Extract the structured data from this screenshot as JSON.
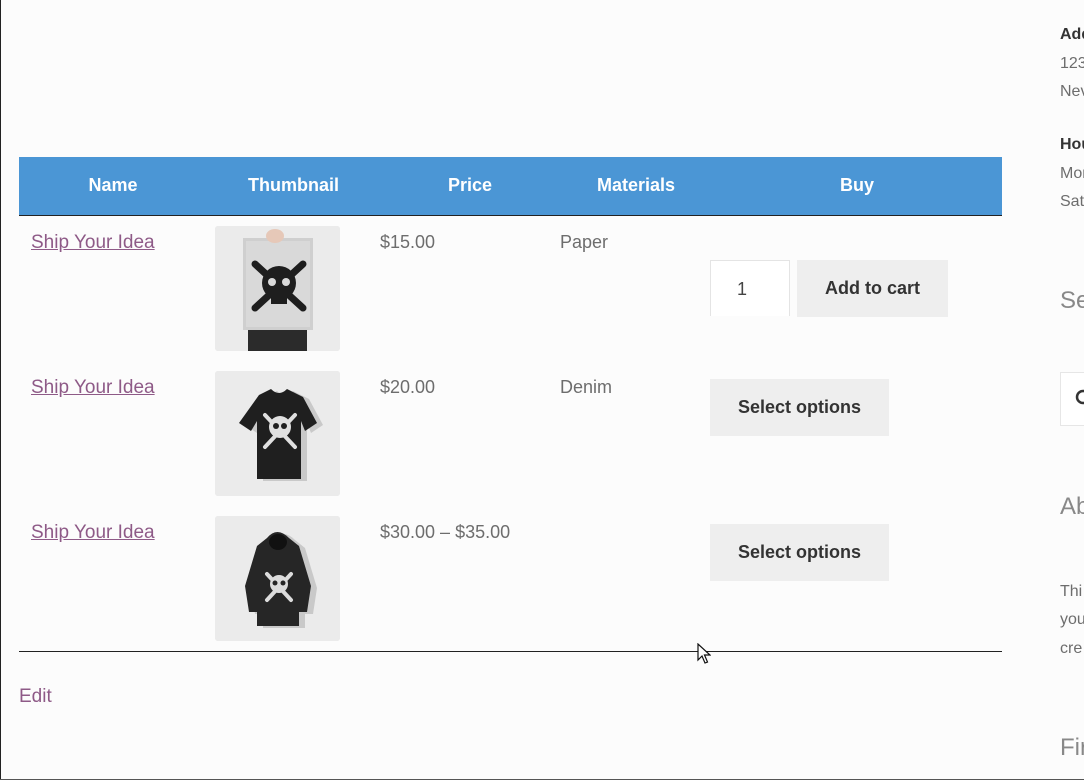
{
  "table": {
    "headers": [
      "Name",
      "Thumbnail",
      "Price",
      "Materials",
      "Buy"
    ],
    "rows": [
      {
        "name": "Ship Your Idea",
        "thumbnail_icon": "poster-icon",
        "price": "$15.00",
        "material": "Paper",
        "quantity": "1",
        "action": "Add to cart"
      },
      {
        "name": "Ship Your Idea",
        "thumbnail_icon": "tshirt-icon",
        "price": "$20.00",
        "material": "Denim",
        "action": "Select options"
      },
      {
        "name": "Ship Your Idea",
        "thumbnail_icon": "hoodie-icon",
        "price": "$30.00 – $35.00",
        "material": "",
        "action": "Select options"
      }
    ]
  },
  "edit_link": "Edit",
  "sidebar": {
    "address_heading": "Add",
    "address_line1": "123",
    "address_line2": "Nev",
    "hours_heading": "Hou",
    "hours_line1": "Mor",
    "hours_line2": "Sat",
    "search_heading": "Se",
    "about_heading": "Ab",
    "about_line1": "Thi",
    "about_line2": "you",
    "about_line3": "cre",
    "find_heading": "Fir"
  },
  "colors": {
    "header_bg": "#4b96d5",
    "link": "#8e5a87",
    "button_bg": "#eeeeee"
  }
}
